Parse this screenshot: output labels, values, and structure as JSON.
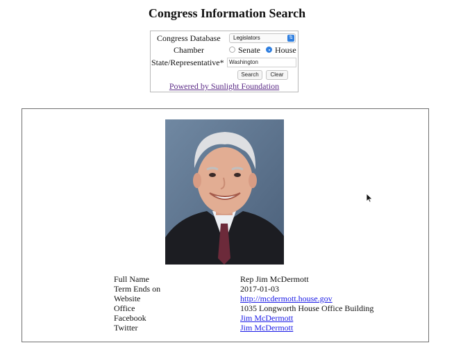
{
  "page": {
    "title": "Congress Information Search"
  },
  "search": {
    "database_label": "Congress Database",
    "database_value": "Legislators",
    "chamber_label": "Chamber",
    "chamber_options": [
      "Senate",
      "House"
    ],
    "chamber_selected": "House",
    "keyword_label": "State/Representative*",
    "keyword_value": "Washington",
    "search_button": "Search",
    "clear_button": "Clear",
    "powered_by": "Powered by Sunlight Foundation"
  },
  "result": {
    "rows": [
      {
        "label": "Full Name",
        "value": "Rep Jim McDermott",
        "link": false
      },
      {
        "label": "Term Ends on",
        "value": "2017-01-03",
        "link": false
      },
      {
        "label": "Website",
        "value": "http://mcdermott.house.gov",
        "link": true
      },
      {
        "label": "Office",
        "value": "1035 Longworth House Office Building",
        "link": false
      },
      {
        "label": "Facebook",
        "value": "Jim McDermott",
        "link": true
      },
      {
        "label": "Twitter",
        "value": "Jim McDermott",
        "link": true
      }
    ]
  },
  "icons": {
    "select_caret": "chevron-updown-icon",
    "cursor": "mouse-pointer-icon"
  },
  "colors": {
    "radio_accent": "#2f7fe0",
    "visited_link": "#5b2a86",
    "link": "#1a1ae6"
  }
}
